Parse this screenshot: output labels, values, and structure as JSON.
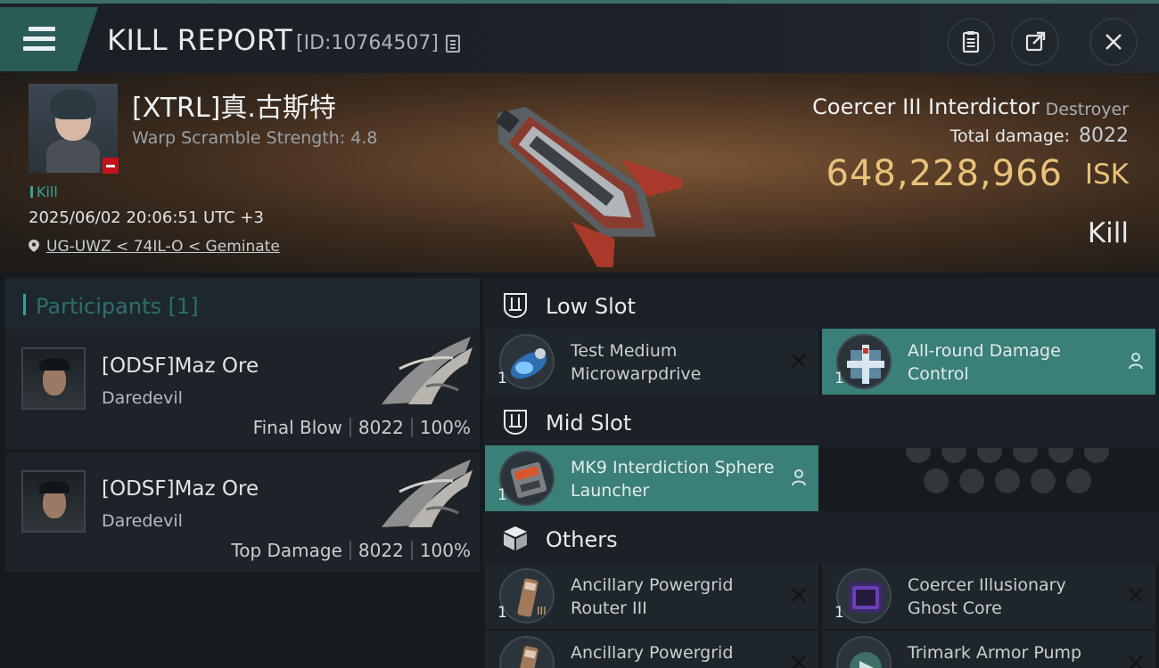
{
  "header": {
    "title": "KILL REPORT",
    "report_id": "[ID:10764507]",
    "menu_icon": "hamburger-icon",
    "buttons": [
      "clipboard-icon",
      "share-icon",
      "close-icon"
    ]
  },
  "victim": {
    "name": "[XTRL]真.古斯特",
    "scramble": "Warp Scramble Strength: 4.8",
    "tag": "Kill",
    "timestamp": "2025/06/02 20:06:51 UTC +3",
    "location": "UG-UWZ < 74IL-O < Geminate",
    "ship_name": "Coercer III Interdictor",
    "ship_class": "Destroyer",
    "total_damage_label": "Total damage:",
    "total_damage": "8022",
    "isk_value": "648,228,966",
    "isk_label": "ISK",
    "result": "Kill"
  },
  "participants": {
    "header": "Participants [1]",
    "list": [
      {
        "name": "[ODSF]Maz Ore",
        "ship": "Daredevil",
        "role": "Final Blow",
        "damage": "8022",
        "percent": "100%"
      },
      {
        "name": "[ODSF]Maz Ore",
        "ship": "Daredevil",
        "role": "Top Damage",
        "damage": "8022",
        "percent": "100%"
      }
    ]
  },
  "fitting": {
    "low_slot": {
      "label": "Low Slot",
      "modules": [
        {
          "name": "Test Medium Microwarpdrive",
          "qty": "1",
          "status": "destroyed"
        },
        {
          "name": "All-round Damage Control",
          "qty": "1",
          "status": "dropped"
        }
      ]
    },
    "mid_slot": {
      "label": "Mid Slot",
      "modules": [
        {
          "name": "MK9 Interdiction Sphere Launcher",
          "qty": "1",
          "status": "dropped"
        }
      ]
    },
    "others": {
      "label": "Others",
      "modules": [
        {
          "name": "Ancillary Powergrid Router III",
          "qty": "1",
          "status": "destroyed"
        },
        {
          "name": "Coercer Illusionary Ghost Core",
          "qty": "1",
          "status": "destroyed"
        },
        {
          "name": "Ancillary Powergrid",
          "qty": "",
          "status": "destroyed"
        },
        {
          "name": "Trimark Armor Pump",
          "qty": "",
          "status": "destroyed"
        }
      ]
    }
  },
  "colors": {
    "accent_teal": "#3a7f78",
    "isk_gold": "#e8c27a",
    "alert_red": "#c3121b"
  }
}
